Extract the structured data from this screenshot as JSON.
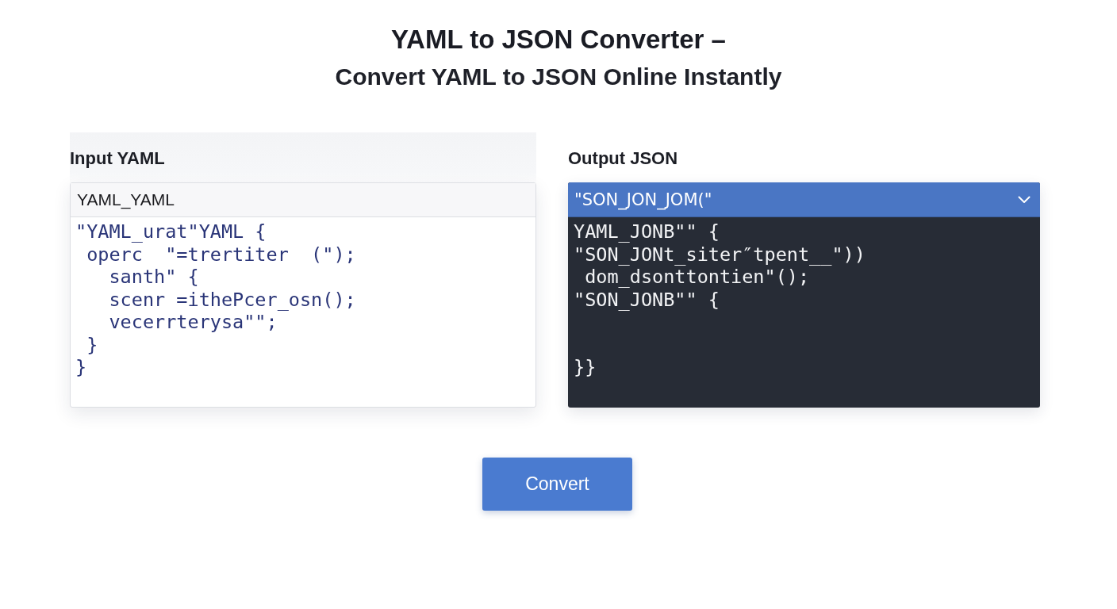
{
  "title": {
    "line_1": "YAML to JSON Converter –",
    "line_2": "Convert YAML to JSON Online Instantly"
  },
  "input_panel": {
    "label": "Input YAML",
    "header": "YAML_YAML",
    "code": "\"YAML_urat\"YAML {\n operc  \"=trertiter  (\");\n   santh\" {\n   scenr =ithePcer_osn();\n   vecerrterysa\"\";\n }\n}"
  },
  "output_panel": {
    "label": "Output JSON",
    "header": "\"SON_JON_JOM(\"",
    "code": "YAML_JONB\"\" {\n\"SON_JONt_siter″tpent__\"))\n dom_dsonttontien\"();\n\"SON_JONB\"\" {\n\n\n}}"
  },
  "convert_button": "Convert"
}
